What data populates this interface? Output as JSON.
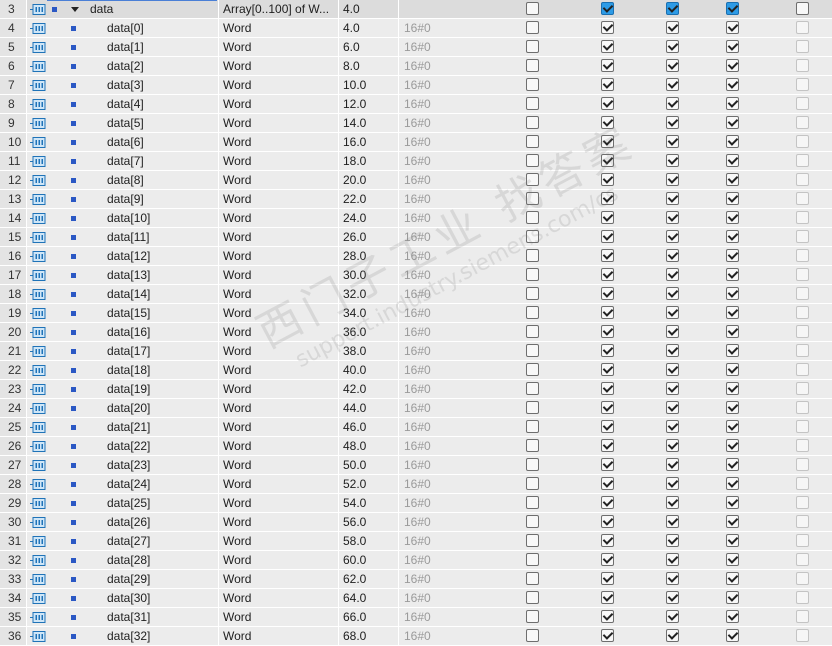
{
  "row_icon": "plc-tag-icon",
  "checkbox_columns": [
    "accessible_from_hmi",
    "writable_from_hmi",
    "visible_in_hmi",
    "setpoint"
  ],
  "header_row": {
    "num": "3",
    "name": "data",
    "type": "Array[0..100] of W...",
    "start": "4.0",
    "default": "",
    "checks": [
      false,
      true,
      true,
      true,
      false
    ]
  },
  "rows": [
    {
      "num": "4",
      "name": "data[0]",
      "type": "Word",
      "start": "4.0",
      "default": "16#0"
    },
    {
      "num": "5",
      "name": "data[1]",
      "type": "Word",
      "start": "6.0",
      "default": "16#0"
    },
    {
      "num": "6",
      "name": "data[2]",
      "type": "Word",
      "start": "8.0",
      "default": "16#0"
    },
    {
      "num": "7",
      "name": "data[3]",
      "type": "Word",
      "start": "10.0",
      "default": "16#0"
    },
    {
      "num": "8",
      "name": "data[4]",
      "type": "Word",
      "start": "12.0",
      "default": "16#0"
    },
    {
      "num": "9",
      "name": "data[5]",
      "type": "Word",
      "start": "14.0",
      "default": "16#0"
    },
    {
      "num": "10",
      "name": "data[6]",
      "type": "Word",
      "start": "16.0",
      "default": "16#0"
    },
    {
      "num": "11",
      "name": "data[7]",
      "type": "Word",
      "start": "18.0",
      "default": "16#0"
    },
    {
      "num": "12",
      "name": "data[8]",
      "type": "Word",
      "start": "20.0",
      "default": "16#0"
    },
    {
      "num": "13",
      "name": "data[9]",
      "type": "Word",
      "start": "22.0",
      "default": "16#0"
    },
    {
      "num": "14",
      "name": "data[10]",
      "type": "Word",
      "start": "24.0",
      "default": "16#0"
    },
    {
      "num": "15",
      "name": "data[11]",
      "type": "Word",
      "start": "26.0",
      "default": "16#0"
    },
    {
      "num": "16",
      "name": "data[12]",
      "type": "Word",
      "start": "28.0",
      "default": "16#0"
    },
    {
      "num": "17",
      "name": "data[13]",
      "type": "Word",
      "start": "30.0",
      "default": "16#0"
    },
    {
      "num": "18",
      "name": "data[14]",
      "type": "Word",
      "start": "32.0",
      "default": "16#0"
    },
    {
      "num": "19",
      "name": "data[15]",
      "type": "Word",
      "start": "34.0",
      "default": "16#0"
    },
    {
      "num": "20",
      "name": "data[16]",
      "type": "Word",
      "start": "36.0",
      "default": "16#0"
    },
    {
      "num": "21",
      "name": "data[17]",
      "type": "Word",
      "start": "38.0",
      "default": "16#0"
    },
    {
      "num": "22",
      "name": "data[18]",
      "type": "Word",
      "start": "40.0",
      "default": "16#0"
    },
    {
      "num": "23",
      "name": "data[19]",
      "type": "Word",
      "start": "42.0",
      "default": "16#0"
    },
    {
      "num": "24",
      "name": "data[20]",
      "type": "Word",
      "start": "44.0",
      "default": "16#0"
    },
    {
      "num": "25",
      "name": "data[21]",
      "type": "Word",
      "start": "46.0",
      "default": "16#0"
    },
    {
      "num": "26",
      "name": "data[22]",
      "type": "Word",
      "start": "48.0",
      "default": "16#0"
    },
    {
      "num": "27",
      "name": "data[23]",
      "type": "Word",
      "start": "50.0",
      "default": "16#0"
    },
    {
      "num": "28",
      "name": "data[24]",
      "type": "Word",
      "start": "52.0",
      "default": "16#0"
    },
    {
      "num": "29",
      "name": "data[25]",
      "type": "Word",
      "start": "54.0",
      "default": "16#0"
    },
    {
      "num": "30",
      "name": "data[26]",
      "type": "Word",
      "start": "56.0",
      "default": "16#0"
    },
    {
      "num": "31",
      "name": "data[27]",
      "type": "Word",
      "start": "58.0",
      "default": "16#0"
    },
    {
      "num": "32",
      "name": "data[28]",
      "type": "Word",
      "start": "60.0",
      "default": "16#0"
    },
    {
      "num": "33",
      "name": "data[29]",
      "type": "Word",
      "start": "62.0",
      "default": "16#0"
    },
    {
      "num": "34",
      "name": "data[30]",
      "type": "Word",
      "start": "64.0",
      "default": "16#0"
    },
    {
      "num": "35",
      "name": "data[31]",
      "type": "Word",
      "start": "66.0",
      "default": "16#0"
    },
    {
      "num": "36",
      "name": "data[32]",
      "type": "Word",
      "start": "68.0",
      "default": "16#0"
    }
  ],
  "element_row_checks": [
    false,
    true,
    true,
    true,
    false
  ],
  "watermark": {
    "line1": "西门子工业 找答案",
    "line2": "support.industry.siemens.com/cs"
  },
  "colors": {
    "accent_blue": "#2d9be6",
    "row_bg": "#ececec",
    "dot_blue": "#2b58c4"
  }
}
